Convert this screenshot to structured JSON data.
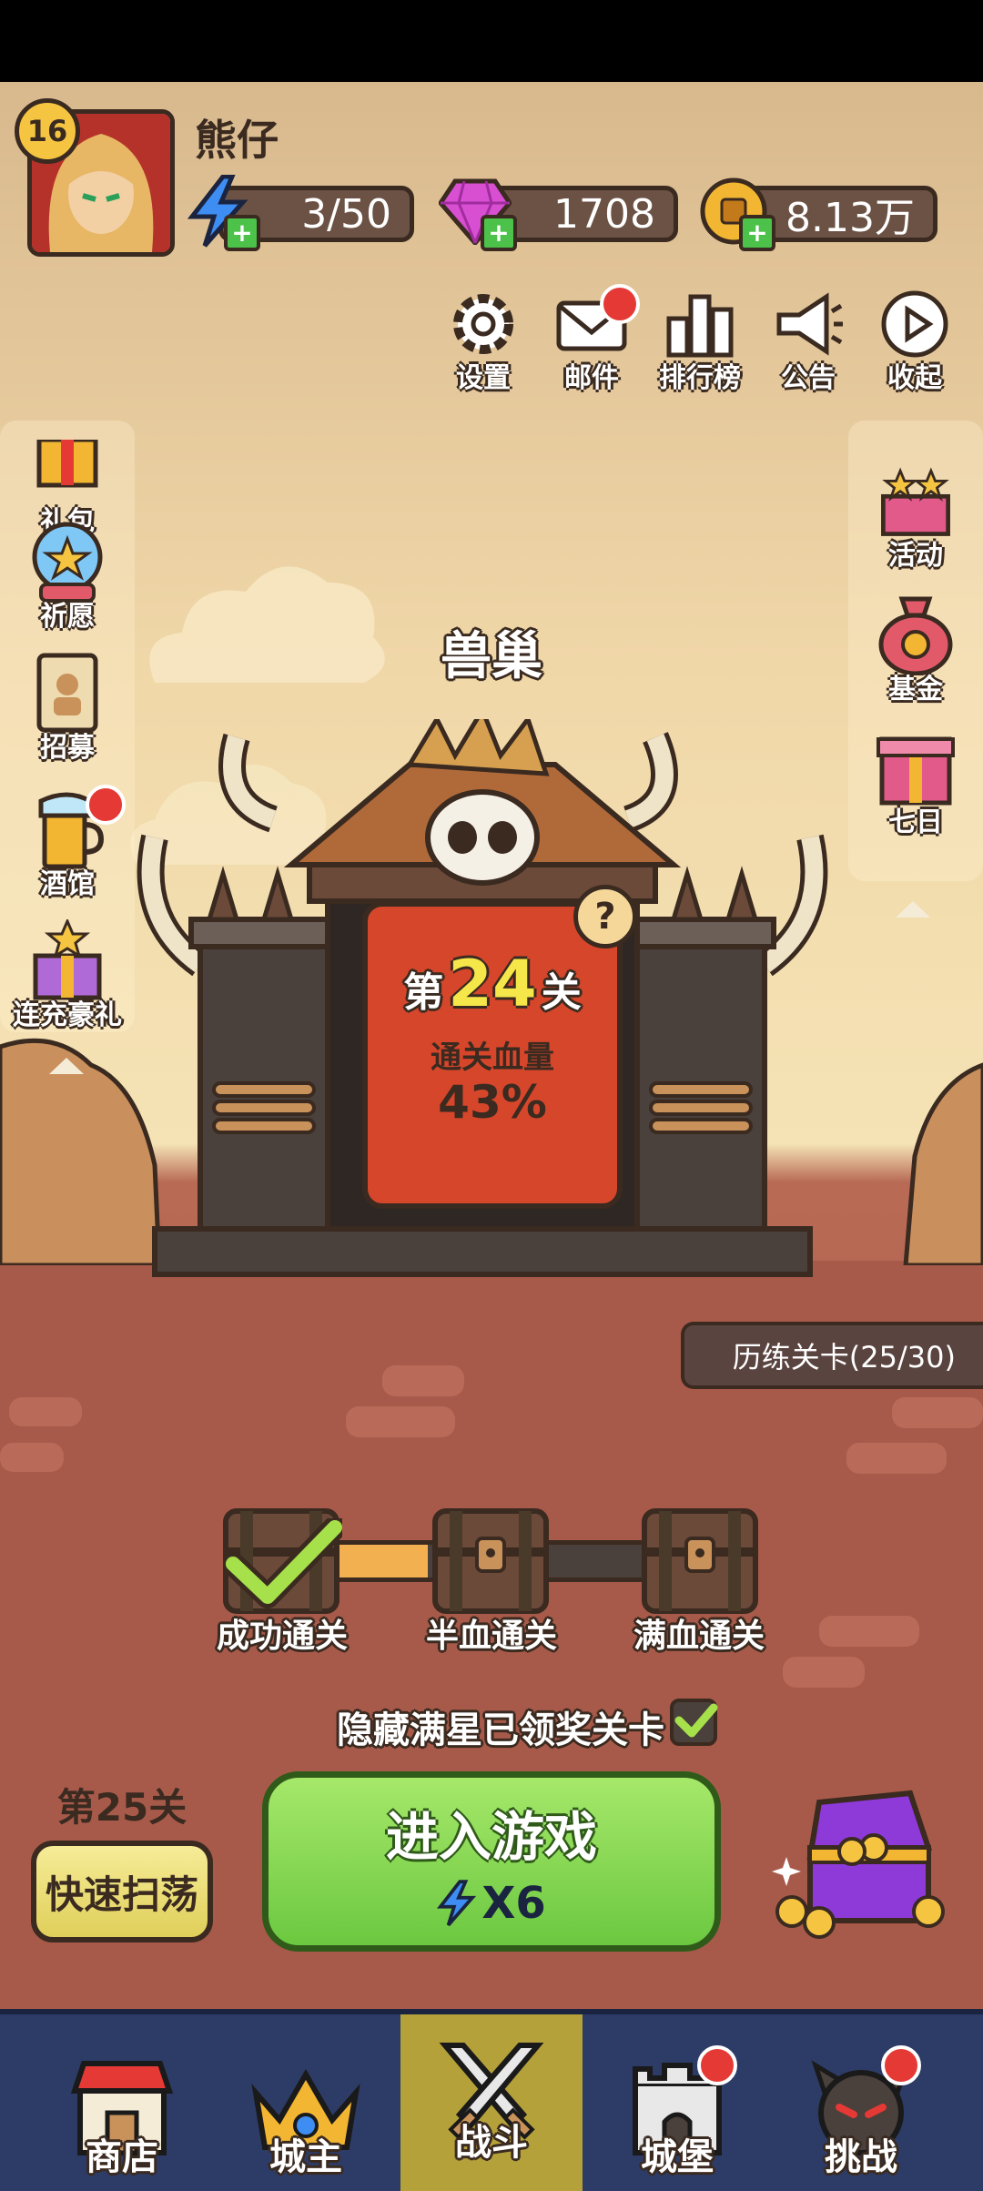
{
  "player": {
    "level": "16",
    "name": "熊仔"
  },
  "resources": {
    "energy": "3/50",
    "gems": "1708",
    "gold": "8.13万"
  },
  "top_buttons": [
    {
      "label": "设置",
      "icon": "gear-icon"
    },
    {
      "label": "邮件",
      "icon": "mail-icon"
    },
    {
      "label": "排行榜",
      "icon": "ranking-icon"
    },
    {
      "label": "公告",
      "icon": "megaphone-icon"
    },
    {
      "label": "收起",
      "icon": "play-icon"
    }
  ],
  "left_menu": [
    {
      "label": "礼包",
      "icon": "gift-pack-icon"
    },
    {
      "label": "祈愿",
      "icon": "wish-star-icon"
    },
    {
      "label": "招募",
      "icon": "recruit-scroll-icon"
    },
    {
      "label": "酒馆",
      "icon": "tavern-beer-icon"
    },
    {
      "label": "连充豪礼",
      "icon": "recharge-gift-icon"
    }
  ],
  "right_menu": [
    {
      "label": "活动",
      "icon": "event-stars-icon"
    },
    {
      "label": "基金",
      "icon": "fund-bag-icon"
    },
    {
      "label": "七日",
      "icon": "seven-day-gift-icon"
    }
  ],
  "stage": {
    "area_name": "兽巢",
    "prefix": "第",
    "number": "24",
    "suffix": "关",
    "hp_label": "通关血量",
    "hp_value": "43%",
    "training_label": "历练关卡(25/30)"
  },
  "rewards": [
    {
      "label": "成功通关",
      "claimed": true
    },
    {
      "label": "半血通关",
      "claimed": false
    },
    {
      "label": "满血通关",
      "claimed": false
    }
  ],
  "hide_claimed_label": "隐藏满星已领奖关卡",
  "sweep": {
    "stage_label": "第25关",
    "button_label": "快速扫荡"
  },
  "enter_game": {
    "label": "进入游戏",
    "cost": "X6"
  },
  "bottom_nav": [
    {
      "label": "商店",
      "icon": "shop-icon",
      "active": false
    },
    {
      "label": "城主",
      "icon": "crown-icon",
      "active": false
    },
    {
      "label": "战斗",
      "icon": "crossed-swords-icon",
      "active": true
    },
    {
      "label": "城堡",
      "icon": "castle-icon",
      "active": false
    },
    {
      "label": "挑战",
      "icon": "demon-icon",
      "active": false
    }
  ],
  "colors": {
    "nav_bg": "#2d3c66",
    "active_tab": "#b5a13a",
    "enter_green": "#7ad64a",
    "sweep_yellow": "#eee07a",
    "gate_red": "#d6462b"
  }
}
